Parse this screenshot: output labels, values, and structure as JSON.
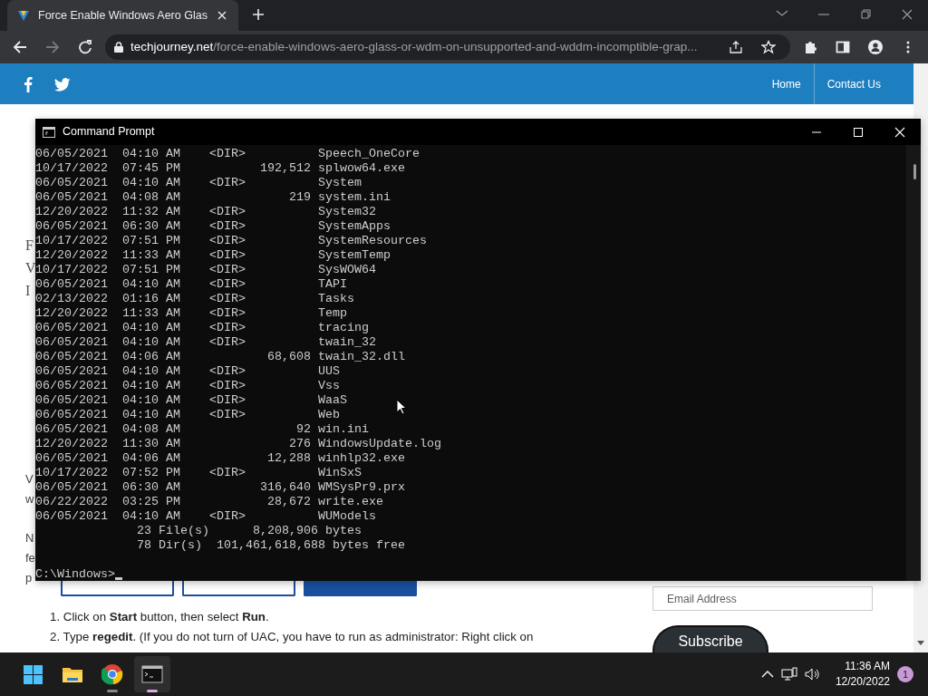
{
  "browser": {
    "tab": {
      "title": "Force Enable Windows Aero Glas",
      "selected": true
    },
    "address": {
      "domain": "techjourney.net",
      "path": "/force-enable-windows-aero-glass-or-wdm-on-unsupported-and-wddm-incomptible-grap..."
    },
    "back_disabled": false,
    "forward_disabled": true
  },
  "site": {
    "nav": [
      {
        "label": "Home"
      },
      {
        "label": "Contact Us"
      }
    ],
    "heading_fragments": [
      "F",
      "V",
      "I"
    ],
    "paragraph_fragments": [
      [
        "V",
        "w"
      ],
      [
        "N",
        "fe",
        "p"
      ]
    ],
    "buttons": [
      {
        "kind": "outline"
      },
      {
        "kind": "outline"
      },
      {
        "kind": "filled"
      }
    ],
    "steps": [
      {
        "number": "1.",
        "text": "Click on **Start** button, then select **Run**."
      },
      {
        "number": "2.",
        "text": "Type **regedit**. (If you do not turn of UAC, you have to run as administrator: Right click on"
      }
    ],
    "email": {
      "placeholder": "Email Address"
    },
    "subscribe": "Subscribe"
  },
  "console": {
    "title": "Command Prompt",
    "entries": [
      {
        "date": "06/05/2021",
        "time": "04:10 AM",
        "kind": "dir",
        "size": "<DIR>",
        "name": "Speech_OneCore"
      },
      {
        "date": "10/17/2022",
        "time": "07:45 PM",
        "kind": "file",
        "size": "192,512",
        "name": "splwow64.exe"
      },
      {
        "date": "06/05/2021",
        "time": "04:10 AM",
        "kind": "dir",
        "size": "<DIR>",
        "name": "System"
      },
      {
        "date": "06/05/2021",
        "time": "04:08 AM",
        "kind": "file",
        "size": "219",
        "name": "system.ini"
      },
      {
        "date": "12/20/2022",
        "time": "11:32 AM",
        "kind": "dir",
        "size": "<DIR>",
        "name": "System32"
      },
      {
        "date": "06/05/2021",
        "time": "06:30 AM",
        "kind": "dir",
        "size": "<DIR>",
        "name": "SystemApps"
      },
      {
        "date": "10/17/2022",
        "time": "07:51 PM",
        "kind": "dir",
        "size": "<DIR>",
        "name": "SystemResources"
      },
      {
        "date": "12/20/2022",
        "time": "11:33 AM",
        "kind": "dir",
        "size": "<DIR>",
        "name": "SystemTemp"
      },
      {
        "date": "10/17/2022",
        "time": "07:51 PM",
        "kind": "dir",
        "size": "<DIR>",
        "name": "SysWOW64"
      },
      {
        "date": "06/05/2021",
        "time": "04:10 AM",
        "kind": "dir",
        "size": "<DIR>",
        "name": "TAPI"
      },
      {
        "date": "02/13/2022",
        "time": "01:16 AM",
        "kind": "dir",
        "size": "<DIR>",
        "name": "Tasks"
      },
      {
        "date": "12/20/2022",
        "time": "11:33 AM",
        "kind": "dir",
        "size": "<DIR>",
        "name": "Temp"
      },
      {
        "date": "06/05/2021",
        "time": "04:10 AM",
        "kind": "dir",
        "size": "<DIR>",
        "name": "tracing"
      },
      {
        "date": "06/05/2021",
        "time": "04:10 AM",
        "kind": "dir",
        "size": "<DIR>",
        "name": "twain_32"
      },
      {
        "date": "06/05/2021",
        "time": "04:06 AM",
        "kind": "file",
        "size": "68,608",
        "name": "twain_32.dll"
      },
      {
        "date": "06/05/2021",
        "time": "04:10 AM",
        "kind": "dir",
        "size": "<DIR>",
        "name": "UUS"
      },
      {
        "date": "06/05/2021",
        "time": "04:10 AM",
        "kind": "dir",
        "size": "<DIR>",
        "name": "Vss"
      },
      {
        "date": "06/05/2021",
        "time": "04:10 AM",
        "kind": "dir",
        "size": "<DIR>",
        "name": "WaaS"
      },
      {
        "date": "06/05/2021",
        "time": "04:10 AM",
        "kind": "dir",
        "size": "<DIR>",
        "name": "Web"
      },
      {
        "date": "06/05/2021",
        "time": "04:08 AM",
        "kind": "file",
        "size": "92",
        "name": "win.ini"
      },
      {
        "date": "12/20/2022",
        "time": "11:30 AM",
        "kind": "file",
        "size": "276",
        "name": "WindowsUpdate.log"
      },
      {
        "date": "06/05/2021",
        "time": "04:06 AM",
        "kind": "file",
        "size": "12,288",
        "name": "winhlp32.exe"
      },
      {
        "date": "10/17/2022",
        "time": "07:52 PM",
        "kind": "dir",
        "size": "<DIR>",
        "name": "WinSxS"
      },
      {
        "date": "06/05/2021",
        "time": "06:30 AM",
        "kind": "file",
        "size": "316,640",
        "name": "WMSysPr9.prx"
      },
      {
        "date": "06/22/2022",
        "time": "03:25 PM",
        "kind": "file",
        "size": "28,672",
        "name": "write.exe"
      },
      {
        "date": "06/05/2021",
        "time": "04:10 AM",
        "kind": "dir",
        "size": "<DIR>",
        "name": "WUModels"
      }
    ],
    "summary": [
      {
        "count": "23",
        "unit": "File(s)",
        "amount": "8,208,906 bytes"
      },
      {
        "count": "78",
        "unit": "Dir(s)",
        "amount": "101,461,618,688 bytes free"
      }
    ],
    "prompt": "C:\\Windows>"
  },
  "taskbar": {
    "apps": [
      {
        "kind": "start",
        "active": false
      },
      {
        "kind": "folder",
        "active": false
      },
      {
        "kind": "chrome",
        "active": false
      },
      {
        "kind": "terminal",
        "active": true
      }
    ],
    "time": "11:36 AM",
    "date": "12/20/2022",
    "notifications": "1"
  }
}
